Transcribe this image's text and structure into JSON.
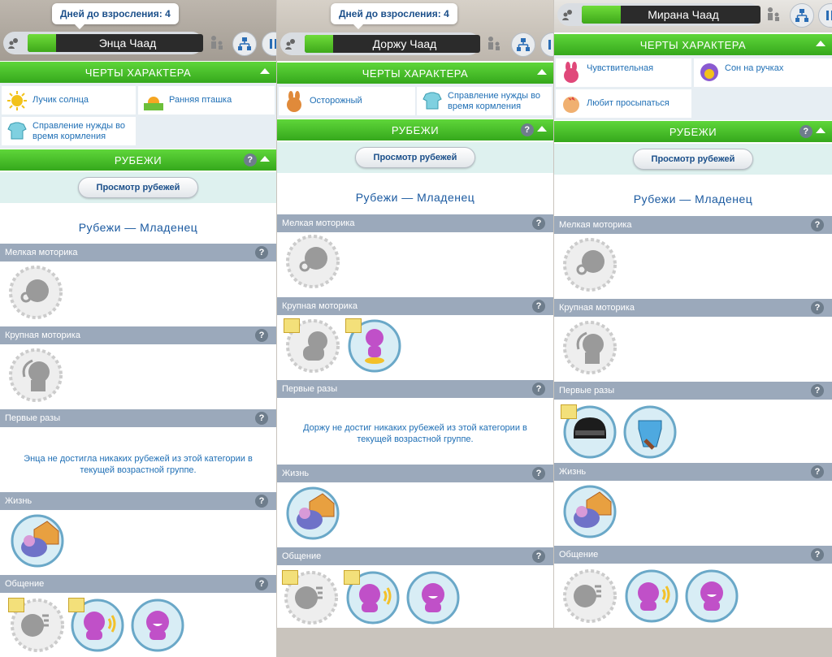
{
  "colors": {
    "trait_header": "#4cc22b",
    "category": "#9ba9bb",
    "link_text": "#1f6fb5",
    "title_text": "#1b5aa0"
  },
  "panels": [
    {
      "tooltip": "Дней до взросления: 4",
      "name": "Энца Чаад",
      "mood_fill": 0.25,
      "traits_header": "Черты характера",
      "traits": [
        {
          "label": "Лучик солнца",
          "icon": "sun-icon"
        },
        {
          "label": "Ранняя пташка",
          "icon": "sunrise-icon"
        },
        {
          "label": "Справление нужды во время кормления",
          "icon": "onesie-icon"
        }
      ],
      "milestones_header": "Рубежи",
      "view_button": "Просмотр рубежей",
      "section_title": "Рубежи — Младенец",
      "categories": [
        {
          "label": "Мелкая моторика"
        },
        {
          "label": "Крупная моторика"
        },
        {
          "label": "Первые разы",
          "message": "Энца не достигла никаких рубежей из этой категории в текущей возрастной группе."
        },
        {
          "label": "Жизнь"
        },
        {
          "label": "Общение"
        }
      ]
    },
    {
      "tooltip": "Дней до взросления: 4",
      "name": "Доржу Чаад",
      "mood_fill": 0.25,
      "traits_header": "Черты характера",
      "traits": [
        {
          "label": "Осторожный",
          "icon": "bunny-icon"
        },
        {
          "label": "Справление нужды во время кормления",
          "icon": "onesie-icon"
        }
      ],
      "milestones_header": "Рубежи",
      "view_button": "Просмотр рубежей",
      "section_title": "Рубежи — Младенец",
      "categories": [
        {
          "label": "Мелкая моторика"
        },
        {
          "label": "Крупная моторика"
        },
        {
          "label": "Первые разы",
          "message": "Доржу не достиг никаких рубежей из этой категории в текущей возрастной группе."
        },
        {
          "label": "Жизнь"
        },
        {
          "label": "Общение"
        }
      ]
    },
    {
      "name": "Мирана Чаад",
      "mood_fill": 0.25,
      "traits_header": "Черты характера",
      "traits": [
        {
          "label": "Чувствительная",
          "icon": "bunny-pink-icon"
        },
        {
          "label": "Сон на ручках",
          "icon": "sleeping-baby-icon"
        },
        {
          "label": "Любит просыпаться",
          "icon": "rooster-icon"
        }
      ],
      "milestones_header": "Рубежи",
      "view_button": "Просмотр рубежей",
      "section_title": "Рубежи — Младенец",
      "categories": [
        {
          "label": "Мелкая моторика"
        },
        {
          "label": "Крупная моторика"
        },
        {
          "label": "Первые разы"
        },
        {
          "label": "Жизнь"
        },
        {
          "label": "Общение"
        }
      ]
    }
  ],
  "question_mark": "?"
}
